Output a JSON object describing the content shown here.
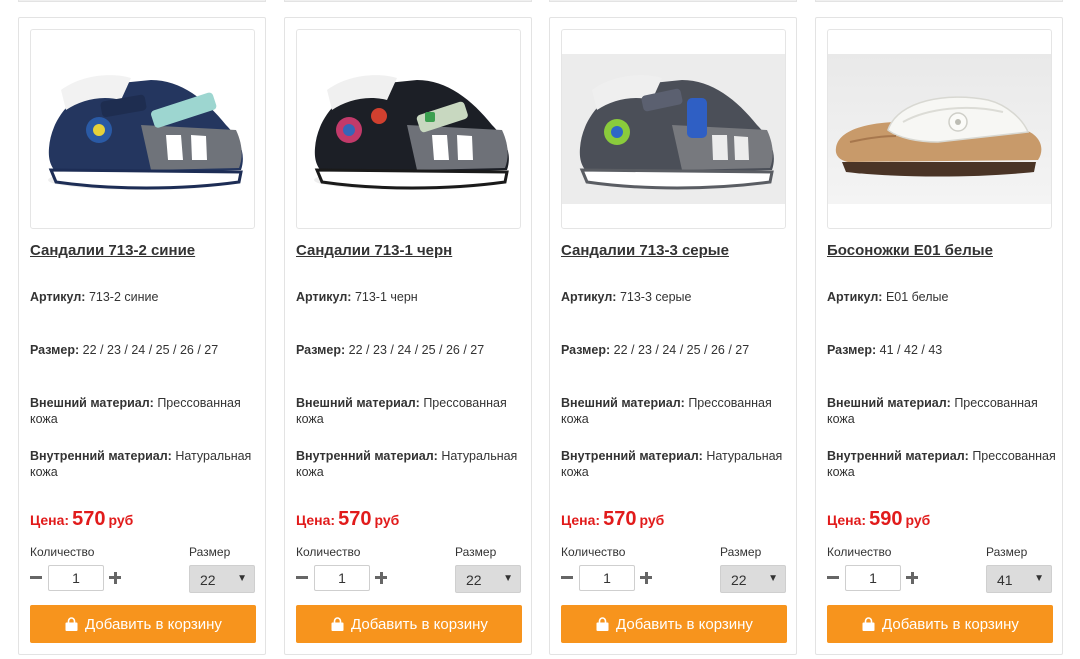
{
  "labels": {
    "article": "Артикул:",
    "size": "Размер:",
    "outer": "Внешний материал:",
    "inner": "Внутренний материал:",
    "price": "Цена:",
    "currency": "руб",
    "quantity": "Количество",
    "size_select": "Размер",
    "add_to_cart": "Добавить в корзину"
  },
  "colors": {
    "price": "#e11b1b",
    "button": "#f7941d"
  },
  "products": [
    {
      "title": "Сандалии 713-2 синие",
      "article": "713-2 синие",
      "sizes": "22 / 23 / 24 / 25 / 26 / 27",
      "outer": "Прессованная кожа",
      "inner": "Натуральная кожа",
      "price": "570",
      "qty": "1",
      "size": "22",
      "image": "navy-sandal-photo"
    },
    {
      "title": "Сандалии 713-1 черн",
      "article": "713-1 черн",
      "sizes": "22 / 23 / 24 / 25 / 26 / 27",
      "outer": "Прессованная кожа",
      "inner": "Натуральная кожа",
      "price": "570",
      "qty": "1",
      "size": "22",
      "image": "black-sandal-photo"
    },
    {
      "title": "Сандалии 713-3 серые",
      "article": "713-3 серые",
      "sizes": "22 / 23 / 24 / 25 / 26 / 27",
      "outer": "Прессованная кожа",
      "inner": "Натуральная кожа",
      "price": "570",
      "qty": "1",
      "size": "22",
      "image": "gray-sandal-photo"
    },
    {
      "title": "Босоножки Е01 белые",
      "article": "Е01 белые",
      "sizes": "41 / 42 / 43",
      "outer": "Прессованная кожа",
      "inner": "Прессованная кожа",
      "price": "590",
      "qty": "1",
      "size": "41",
      "image": "white-slide-photo"
    }
  ]
}
